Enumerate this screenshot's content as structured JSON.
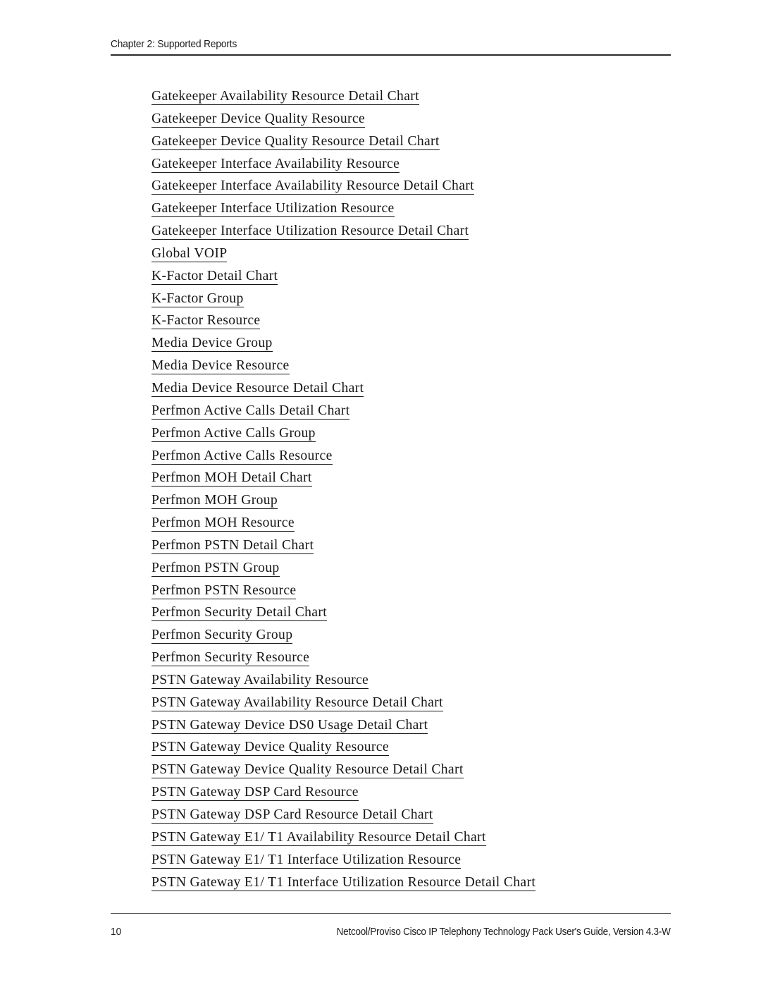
{
  "header": {
    "chapter_label": "Chapter 2: Supported Reports"
  },
  "report_list": [
    {
      "label": "Gatekeeper Availability Resource Detail Chart"
    },
    {
      "label": "Gatekeeper Device Quality Resource"
    },
    {
      "label": "Gatekeeper Device Quality Resource Detail Chart"
    },
    {
      "label": "Gatekeeper Interface Availability Resource"
    },
    {
      "label": "Gatekeeper Interface Availability Resource Detail Chart"
    },
    {
      "label": "Gatekeeper Interface Utilization Resource"
    },
    {
      "label": "Gatekeeper Interface Utilization Resource Detail Chart"
    },
    {
      "label": "Global VOIP"
    },
    {
      "label": "K-Factor Detail Chart"
    },
    {
      "label": "K-Factor Group"
    },
    {
      "label": "K-Factor Resource"
    },
    {
      "label": "Media Device Group"
    },
    {
      "label": "Media Device Resource"
    },
    {
      "label": "Media Device Resource Detail Chart"
    },
    {
      "label": "Perfmon Active Calls Detail Chart"
    },
    {
      "label": "Perfmon Active Calls Group"
    },
    {
      "label": "Perfmon Active Calls Resource"
    },
    {
      "label": "Perfmon MOH Detail Chart"
    },
    {
      "label": "Perfmon MOH Group"
    },
    {
      "label": "Perfmon MOH Resource"
    },
    {
      "label": "Perfmon PSTN Detail Chart"
    },
    {
      "label": "Perfmon PSTN Group"
    },
    {
      "label": "Perfmon PSTN Resource"
    },
    {
      "label": "Perfmon Security Detail Chart"
    },
    {
      "label": "Perfmon Security Group"
    },
    {
      "label": "Perfmon Security Resource"
    },
    {
      "label": "PSTN Gateway Availability Resource"
    },
    {
      "label": "PSTN Gateway Availability Resource Detail Chart"
    },
    {
      "label": "PSTN Gateway Device DS0 Usage Detail Chart"
    },
    {
      "label": "PSTN Gateway Device Quality Resource"
    },
    {
      "label": "PSTN Gateway Device Quality Resource Detail Chart"
    },
    {
      "label": "PSTN Gateway DSP Card Resource"
    },
    {
      "label": "PSTN Gateway DSP Card Resource Detail Chart"
    },
    {
      "label": "PSTN Gateway E1/ T1 Availability Resource Detail Chart"
    },
    {
      "label": "PSTN Gateway E1/ T1 Interface Utilization Resource"
    },
    {
      "label": "PSTN Gateway E1/ T1 Interface Utilization Resource Detail Chart"
    }
  ],
  "footer": {
    "page_number": "10",
    "document_title": "Netcool/Proviso Cisco IP Telephony Technology Pack User's Guide, Version 4.3-W"
  },
  "colors": {
    "text": "#151515",
    "header_rule": "#2b2b2b",
    "footer_rule": "#575757",
    "page_background": "#ffffff"
  }
}
